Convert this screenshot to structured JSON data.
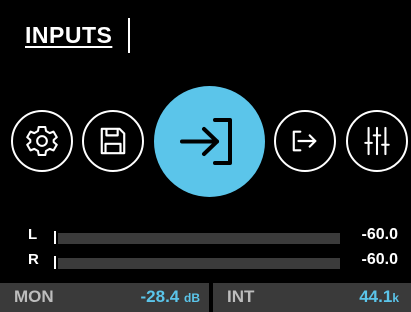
{
  "screen": {
    "title": "INPUTS"
  },
  "nav": {
    "items": [
      {
        "icon": "gear-icon",
        "label": ""
      },
      {
        "icon": "save-icon",
        "label": ""
      },
      {
        "icon": "input-icon",
        "label": "",
        "active": true
      },
      {
        "icon": "output-icon",
        "label": ""
      },
      {
        "icon": "mixer-icon",
        "label": ""
      }
    ]
  },
  "meters": {
    "left": {
      "channel": "L",
      "value": "-60.0",
      "level": 0
    },
    "right": {
      "channel": "R",
      "value": "-60.0",
      "level": 0
    }
  },
  "status": {
    "mon_label": "MON",
    "mon_value": "-28.4",
    "mon_unit": "dB",
    "int_label": "INT",
    "int_value": "44.1",
    "int_unit": "k"
  },
  "colors": {
    "accent": "#5bc5ea",
    "background": "#000000",
    "track": "#3b3b3b",
    "status_bg": "#3a3a3a"
  }
}
